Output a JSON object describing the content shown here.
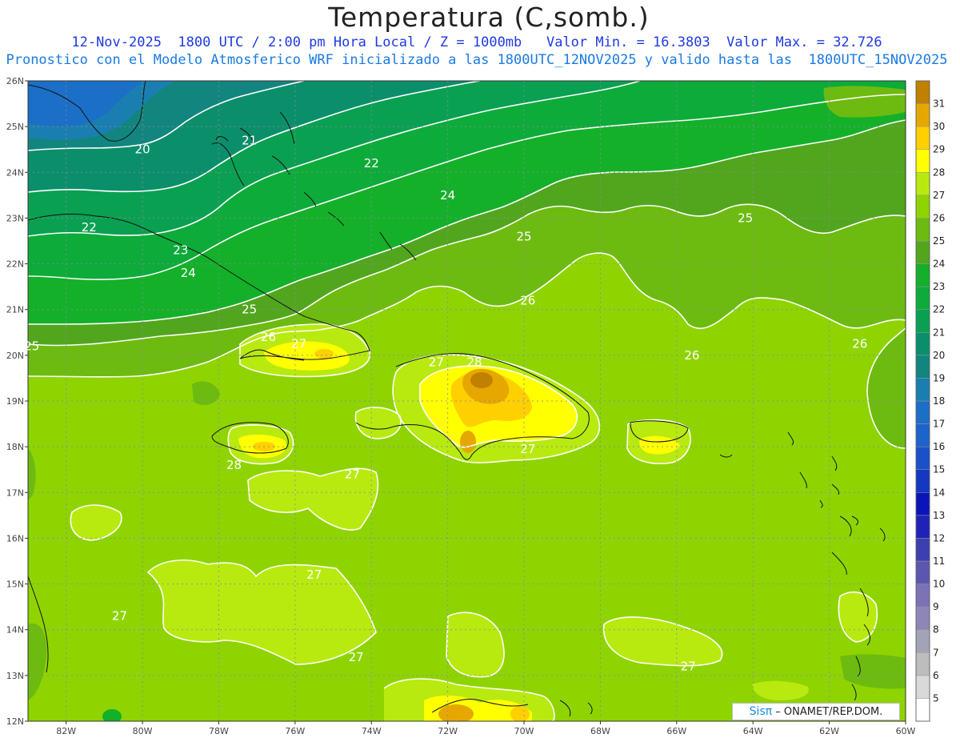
{
  "title": "Temperatura (C,somb.)",
  "subtitle1": "12-Nov-2025  1800 UTC / 2:00 pm Hora Local / Z = 1000mb   Valor Min. = 16.3803  Valor Max. = 32.726",
  "subtitle2": "Pronostico con el Modelo Atmosferico WRF inicializado a las 1800UTC_12NOV2025 y valido hasta las  1800UTC_15NOV2025",
  "credit": {
    "brand": "Sisπ",
    "text": " –  ONAMET/REP.DOM."
  },
  "lat_labels": [
    "26N",
    "25N",
    "24N",
    "23N",
    "22N",
    "21N",
    "20N",
    "19N",
    "18N",
    "17N",
    "16N",
    "15N",
    "14N",
    "13N",
    "12N"
  ],
  "lon_labels": [
    "82W",
    "80W",
    "78W",
    "76W",
    "74W",
    "72W",
    "70W",
    "68W",
    "66W",
    "64W",
    "62W",
    "60W"
  ],
  "contour_labels": [
    {
      "text": "20",
      "lon": -80.0,
      "lat": 24.5
    },
    {
      "text": "21",
      "lon": -77.2,
      "lat": 24.7
    },
    {
      "text": "22",
      "lon": -74.0,
      "lat": 24.2
    },
    {
      "text": "24",
      "lon": -72.0,
      "lat": 23.5
    },
    {
      "text": "25",
      "lon": -70.0,
      "lat": 22.6
    },
    {
      "text": "22",
      "lon": -81.4,
      "lat": 22.8
    },
    {
      "text": "23",
      "lon": -79.0,
      "lat": 22.3
    },
    {
      "text": "24",
      "lon": -78.8,
      "lat": 21.8
    },
    {
      "text": "25",
      "lon": -77.2,
      "lat": 21.0
    },
    {
      "text": "26",
      "lon": -69.9,
      "lat": 21.2
    },
    {
      "text": "25",
      "lon": -82.9,
      "lat": 20.2
    },
    {
      "text": "26",
      "lon": -76.7,
      "lat": 20.4
    },
    {
      "text": "27",
      "lon": -75.9,
      "lat": 20.25
    },
    {
      "text": "27",
      "lon": -72.3,
      "lat": 19.85
    },
    {
      "text": "28",
      "lon": -71.3,
      "lat": 19.85
    },
    {
      "text": "26",
      "lon": -65.6,
      "lat": 20.0
    },
    {
      "text": "26",
      "lon": -61.2,
      "lat": 20.25
    },
    {
      "text": "25",
      "lon": -64.2,
      "lat": 23.0
    },
    {
      "text": "27",
      "lon": -69.9,
      "lat": 17.95
    },
    {
      "text": "28",
      "lon": -77.6,
      "lat": 17.6
    },
    {
      "text": "27",
      "lon": -74.5,
      "lat": 17.4
    },
    {
      "text": "27",
      "lon": -75.5,
      "lat": 15.2
    },
    {
      "text": "27",
      "lon": -80.6,
      "lat": 14.3
    },
    {
      "text": "27",
      "lon": -74.4,
      "lat": 13.4
    },
    {
      "text": "27",
      "lon": -65.7,
      "lat": 13.2
    }
  ],
  "colorbar": {
    "levels": [
      "5",
      "6",
      "7",
      "8",
      "9",
      "10",
      "11",
      "12",
      "13",
      "14",
      "15",
      "16",
      "17",
      "18",
      "19",
      "20",
      "21",
      "22",
      "23",
      "24",
      "25",
      "26",
      "27",
      "28",
      "29",
      "30",
      "31"
    ],
    "colors": [
      "#ffffff",
      "#d9d9d9",
      "#bdbdbd",
      "#a3a3b8",
      "#8f86b8",
      "#7c73b6",
      "#5c56b0",
      "#3b3fb0",
      "#1f22b6",
      "#0a14b8",
      "#1438c0",
      "#1a50c8",
      "#1d63cc",
      "#1b6fc6",
      "#1a7fb0",
      "#12857f",
      "#0b8f6a",
      "#0aa052",
      "#0dab3a",
      "#14b02a",
      "#52a61e",
      "#6dbb10",
      "#8fd400",
      "#b8ea10",
      "#ffff00",
      "#ffd000",
      "#e6a800",
      "#c08000"
    ]
  }
}
